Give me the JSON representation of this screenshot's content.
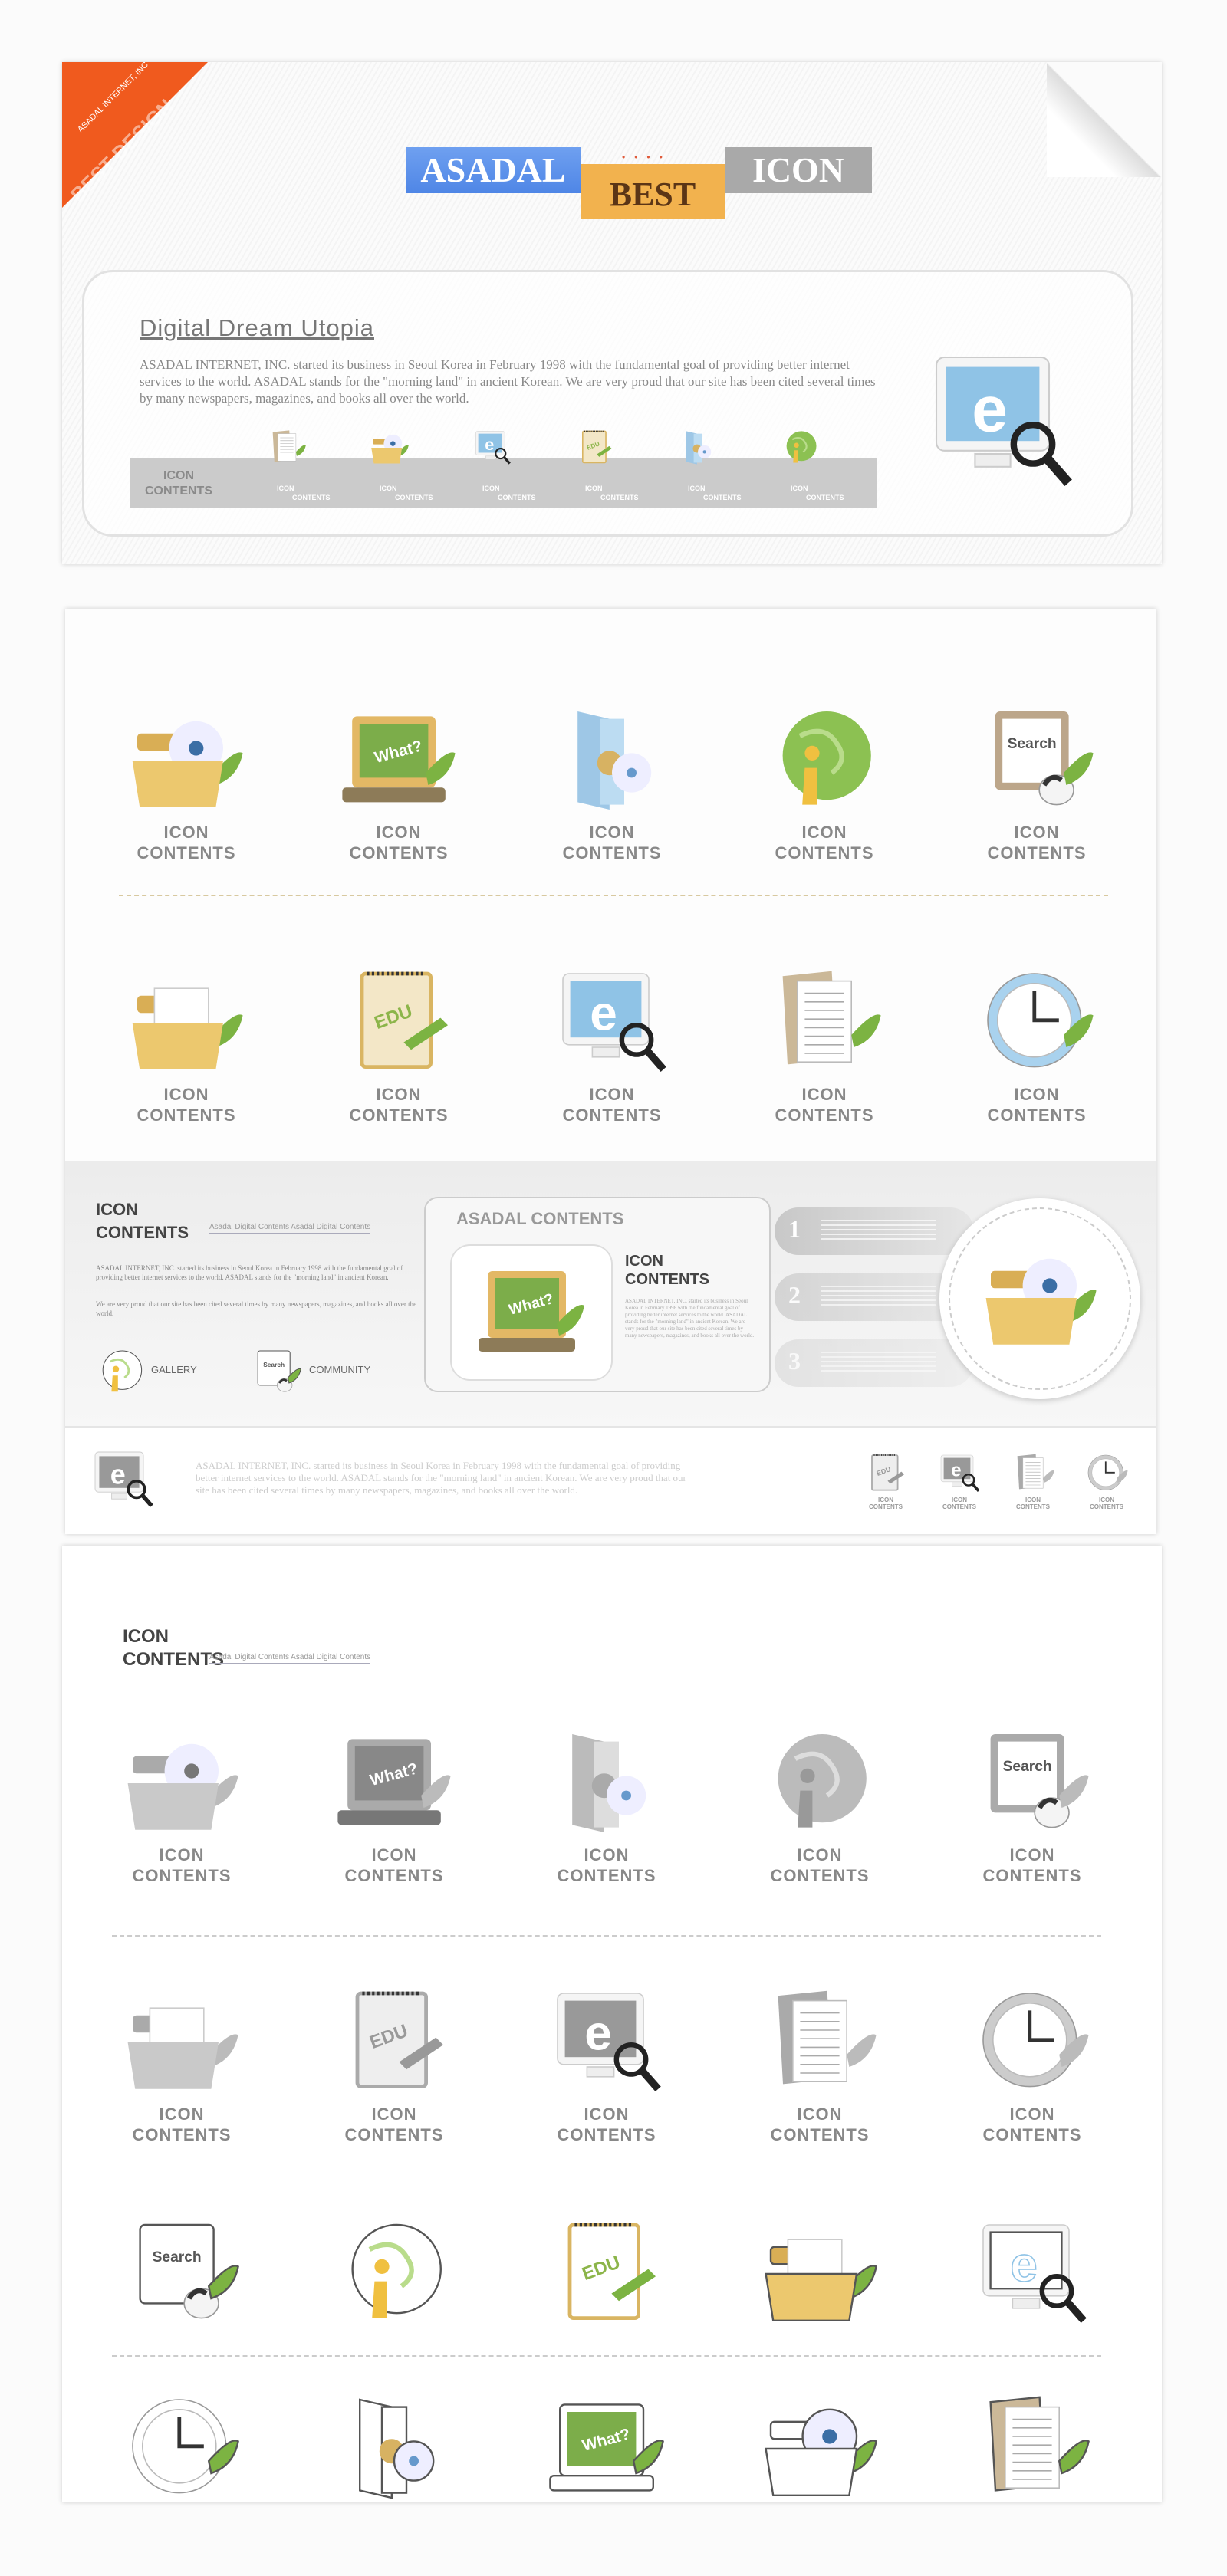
{
  "header": {
    "ribbon_small": "ASADAL INTERNET, INC",
    "ribbon_big": "BEST DESIGN",
    "badge_1": "ASADAL",
    "badge_2": "BEST",
    "badge_3": "ICON"
  },
  "intro": {
    "title": "Digital  Dream  Utopia",
    "paragraph": "ASADAL INTERNET, INC. started its business in Seoul Korea in February 1998 with the fundamental goal of providing better internet services to the world. ASADAL stands for the \"morning land\" in ancient Korean. We are very proud that our site has been cited several times by many newspapers, magazines, and books all over the world.",
    "strip_label_1": "ICON",
    "strip_label_2": "CONTENTS",
    "strip_items": [
      {
        "icon": "documents",
        "l1": "ICON",
        "l2": "CONTENTS"
      },
      {
        "icon": "folder-cd",
        "l1": "ICON",
        "l2": "CONTENTS"
      },
      {
        "icon": "monitor-e",
        "l1": "ICON",
        "l2": "CONTENTS"
      },
      {
        "icon": "notepad-edu",
        "l1": "ICON",
        "l2": "CONTENTS"
      },
      {
        "icon": "door-cd",
        "l1": "ICON",
        "l2": "CONTENTS"
      },
      {
        "icon": "globe-info",
        "l1": "ICON",
        "l2": "CONTENTS"
      }
    ],
    "hero_icon": "monitor-e"
  },
  "color_grid": {
    "label_1": "ICON",
    "label_2": "CONTENTS",
    "rows": [
      [
        "folder-cd",
        "chalkboard-what",
        "door-cd",
        "globe-info",
        "search-mouse"
      ],
      [
        "folder-papers",
        "notepad-edu",
        "monitor-e",
        "documents",
        "clock"
      ]
    ]
  },
  "band": {
    "title_1": "ICON",
    "title_2": "CONTENTS",
    "subtitle": "Asadal Digital Contents  Asadal Digital Contents",
    "para_1": "ASADAL INTERNET, INC. started its business in Seoul Korea in February 1998 with the fundamental goal of providing better internet services to the world. ASADAL stands for the \"morning land\" in ancient Korean.",
    "para_2": "We are very proud that our site has been cited several times by many newspapers, magazines, and books all over the world.",
    "gallery": "GALLERY",
    "community": "COMMUNITY",
    "box_title": "ASADAL CONTENTS",
    "box_label_1": "ICON",
    "box_label_2": "CONTENTS",
    "box_text": "ASADAL INTERNET, INC. started its business in Seoul Korea in February 1998 with the fundamental goal of providing better internet services to the world. ASADAL stands for the \"morning land\" in ancient Korean. We are very proud that our site has been cited several times by many newspapers, magazines, and books all over the world.",
    "steps": [
      "1",
      "2",
      "3"
    ]
  },
  "footer": {
    "paragraph": "ASADAL INTERNET, INC. started its business in Seoul Korea in February 1998 with the fundamental goal of providing better internet services to the world. ASADAL stands for the \"morning land\" in ancient Korean. We are very proud that our site has been cited several times by many newspapers, magazines, and books all over the world.",
    "icons": [
      "notepad-edu",
      "monitor-e",
      "documents",
      "clock"
    ],
    "l1": "ICON",
    "l2": "CONTENTS"
  },
  "gray_section": {
    "title_1": "ICON",
    "title_2": "CONTENTS",
    "subtitle": "Asadal Digital Contents  Asadal Digital Contents",
    "gray_rows": [
      [
        "folder-cd",
        "chalkboard-what",
        "door-cd",
        "globe-info",
        "search-mouse"
      ],
      [
        "folder-papers",
        "notepad-edu",
        "monitor-e",
        "documents",
        "clock"
      ]
    ],
    "line_rows": [
      [
        "search-mouse",
        "globe-info",
        "notepad-edu",
        "folder-papers",
        "monitor-e"
      ],
      [
        "clock",
        "door-cd",
        "chalkboard-what",
        "folder-cd",
        "documents"
      ]
    ]
  },
  "colors": {
    "ribbon": "#f05a1e",
    "asadal_blue": "#4f86e6",
    "best_orange": "#f2b24e",
    "icon_gray": "#a9a9a9",
    "folder": "#e9c46f",
    "leaf": "#7cb342",
    "board": "#7cad4a"
  }
}
